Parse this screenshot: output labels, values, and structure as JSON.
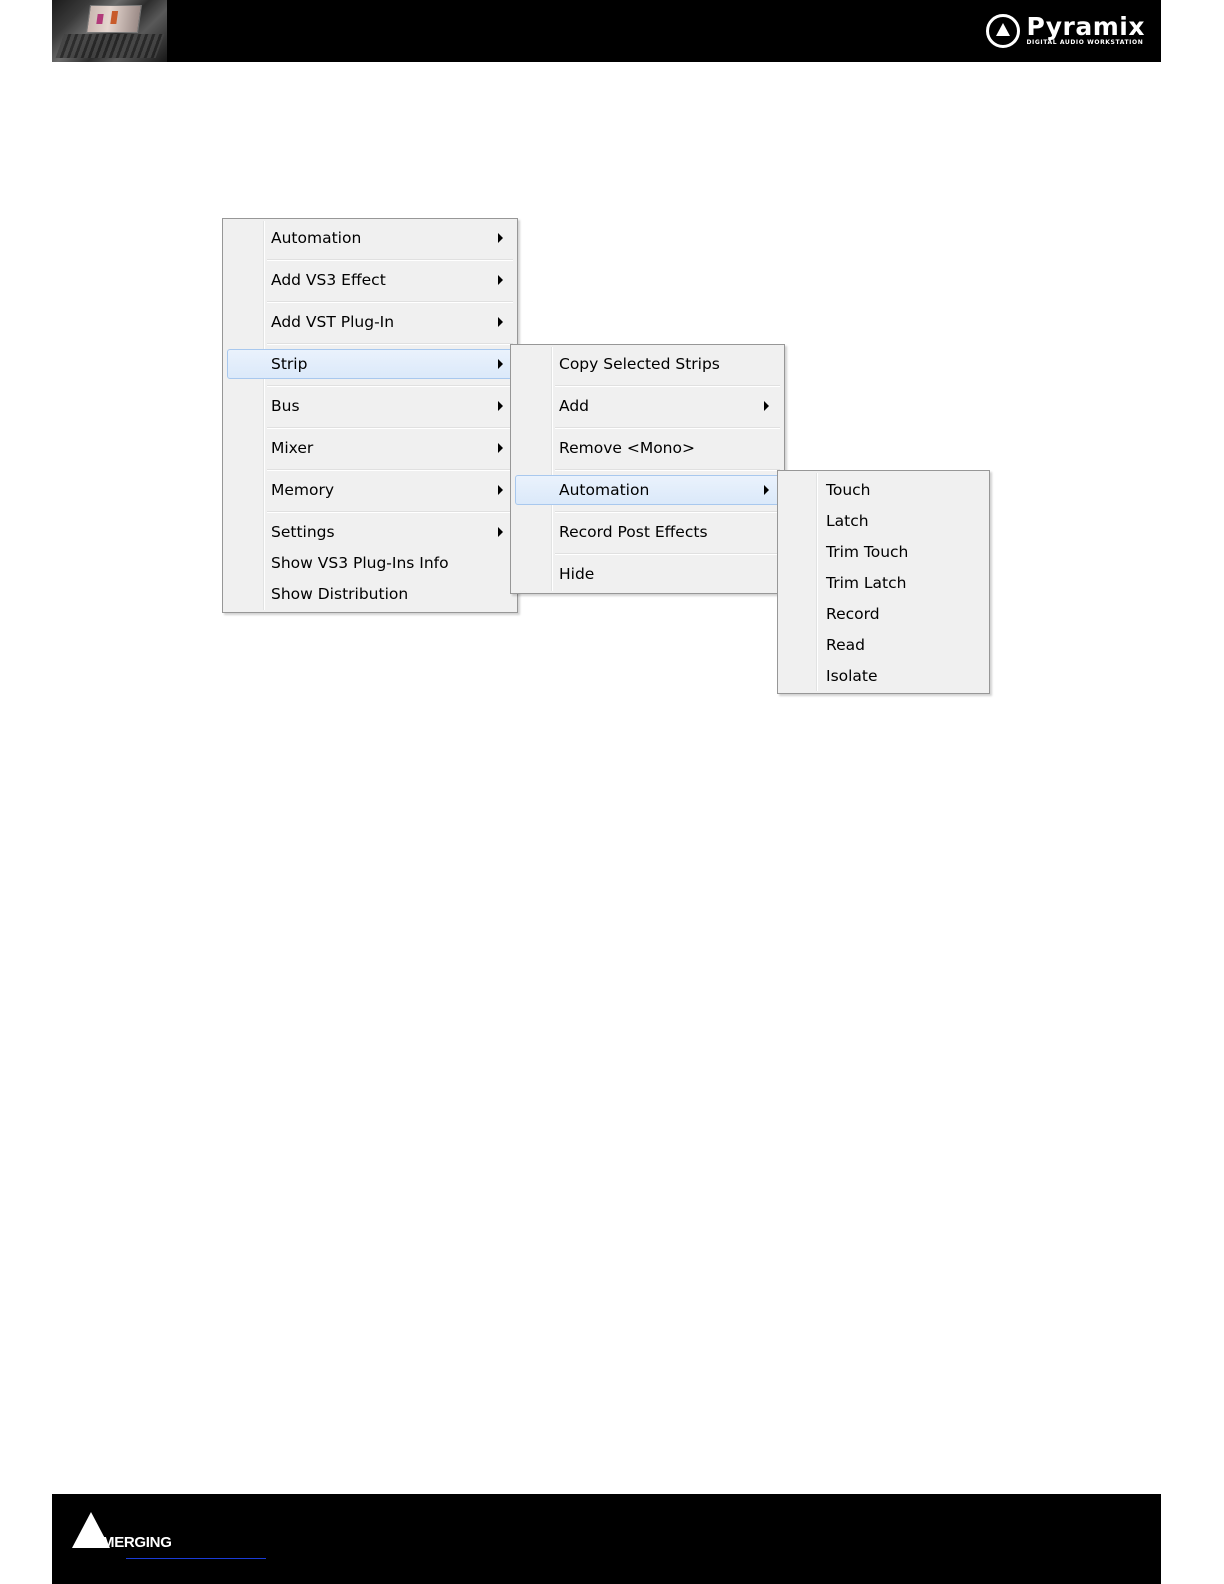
{
  "header": {
    "brand_name": "Pyramix",
    "brand_subtitle": "DIGITAL AUDIO WORKSTATION",
    "brand_icon": "pyramix-logo-icon",
    "photo": "studio-photo"
  },
  "menu_main": {
    "items": [
      {
        "label": "Automation",
        "submenu": true
      },
      {
        "label": "Add VS3 Effect",
        "submenu": true
      },
      {
        "label": "Add VST Plug-In",
        "submenu": true
      },
      {
        "label": "Strip",
        "submenu": true,
        "highlighted": true
      },
      {
        "label": "Bus",
        "submenu": true
      },
      {
        "label": "Mixer",
        "submenu": true
      },
      {
        "label": "Memory",
        "submenu": true
      },
      {
        "label": "Settings",
        "submenu": true
      },
      {
        "label": "Show VS3 Plug-Ins Info",
        "submenu": false
      },
      {
        "label": "Show Distribution",
        "submenu": false
      }
    ]
  },
  "menu_strip": {
    "items": [
      {
        "label": "Copy Selected Strips",
        "submenu": false
      },
      {
        "label": "Add",
        "submenu": true
      },
      {
        "label": "Remove <Mono>",
        "submenu": false
      },
      {
        "label": "Automation",
        "submenu": true,
        "highlighted": true
      },
      {
        "label": "Record Post Effects",
        "submenu": false
      },
      {
        "label": "Hide",
        "submenu": false
      }
    ]
  },
  "menu_automation": {
    "items": [
      {
        "label": "Touch"
      },
      {
        "label": "Latch"
      },
      {
        "label": "Trim Touch"
      },
      {
        "label": "Trim Latch"
      },
      {
        "label": "Record"
      },
      {
        "label": "Read"
      },
      {
        "label": "Isolate"
      }
    ]
  },
  "footer": {
    "company": "MERGING",
    "logo_icon": "merging-logo-icon"
  },
  "colors": {
    "menu_bg": "#f0f0f0",
    "menu_border": "#979797",
    "highlight": "#dbe9fa",
    "bar": "#000000"
  }
}
